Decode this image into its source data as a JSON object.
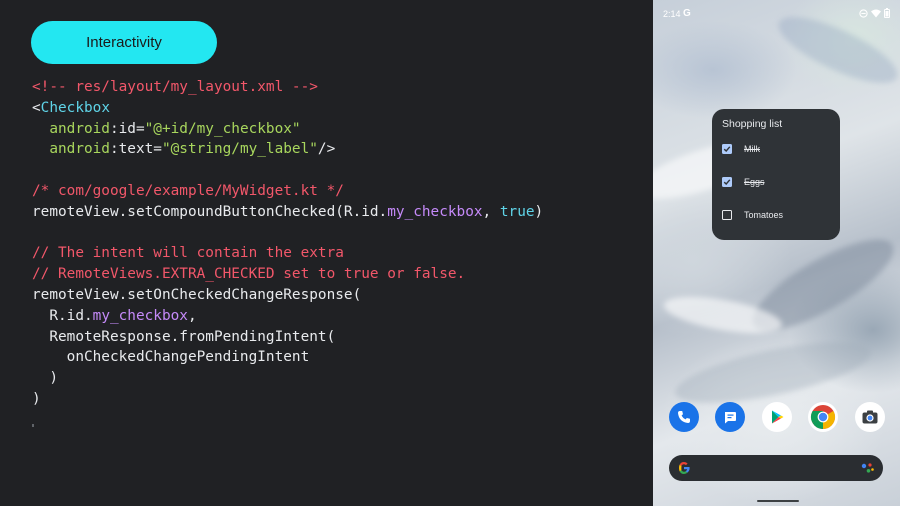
{
  "slide": {
    "pill_label": "Interactivity",
    "code_lines": [
      {
        "parts": [
          {
            "t": "<!-- res/layout/my_layout.xml -->",
            "c": "c-comment"
          }
        ]
      },
      {
        "parts": [
          {
            "t": "<",
            "c": "c-punc"
          },
          {
            "t": "Checkbox",
            "c": "c-tag"
          }
        ]
      },
      {
        "parts": [
          {
            "t": "  android",
            "c": "c-attr"
          },
          {
            "t": ":id=",
            "c": "c-punc"
          },
          {
            "t": "\"@+id/my_checkbox\"",
            "c": "c-str"
          }
        ]
      },
      {
        "parts": [
          {
            "t": "  android",
            "c": "c-attr"
          },
          {
            "t": ":text=",
            "c": "c-punc"
          },
          {
            "t": "\"@string/my_label\"",
            "c": "c-str"
          },
          {
            "t": "/>",
            "c": "c-punc"
          }
        ]
      },
      {
        "parts": [
          {
            "t": "",
            "c": "c-punc"
          }
        ]
      },
      {
        "parts": [
          {
            "t": "/* com/google/example/MyWidget.kt */",
            "c": "c-comment"
          }
        ]
      },
      {
        "parts": [
          {
            "t": "remoteView.setCompoundButtonChecked(R.id.",
            "c": "c-punc"
          },
          {
            "t": "my_checkbox",
            "c": "c-id"
          },
          {
            "t": ", ",
            "c": "c-punc"
          },
          {
            "t": "true",
            "c": "c-bool"
          },
          {
            "t": ")",
            "c": "c-punc"
          }
        ]
      },
      {
        "parts": [
          {
            "t": "",
            "c": "c-punc"
          }
        ]
      },
      {
        "parts": [
          {
            "t": "// The intent will contain the extra",
            "c": "c-comment"
          }
        ]
      },
      {
        "parts": [
          {
            "t": "// RemoteViews.EXTRA_CHECKED set to true or false.",
            "c": "c-comment"
          }
        ]
      },
      {
        "parts": [
          {
            "t": "remoteView.setOnCheckedChangeResponse(",
            "c": "c-punc"
          }
        ]
      },
      {
        "parts": [
          {
            "t": "  R.id.",
            "c": "c-punc"
          },
          {
            "t": "my_checkbox",
            "c": "c-id"
          },
          {
            "t": ",",
            "c": "c-punc"
          }
        ]
      },
      {
        "parts": [
          {
            "t": "  RemoteResponse.fromPendingIntent(",
            "c": "c-punc"
          }
        ]
      },
      {
        "parts": [
          {
            "t": "    onCheckedChangePendingIntent",
            "c": "c-punc"
          }
        ]
      },
      {
        "parts": [
          {
            "t": "  )",
            "c": "c-punc"
          }
        ]
      },
      {
        "parts": [
          {
            "t": ")",
            "c": "c-punc"
          }
        ]
      }
    ]
  },
  "phone": {
    "status": {
      "time": "2:14",
      "g_label": "G"
    },
    "widget": {
      "title": "Shopping list",
      "items": [
        {
          "label": "Milk",
          "checked": true
        },
        {
          "label": "Eggs",
          "checked": true
        },
        {
          "label": "Tomatoes",
          "checked": false
        }
      ]
    },
    "dock_apps": [
      "phone-icon",
      "messages-icon",
      "play-store-icon",
      "chrome-icon",
      "camera-icon"
    ],
    "search": {
      "g_label": "G"
    }
  },
  "colors": {
    "accent": "#23e7f1",
    "comment": "#f2576a",
    "tag": "#5fd4e8",
    "attr": "#a8d65d",
    "identifier": "#c58af9",
    "widget_bg": "#2f3337",
    "checkbox": "#aecbfa"
  }
}
